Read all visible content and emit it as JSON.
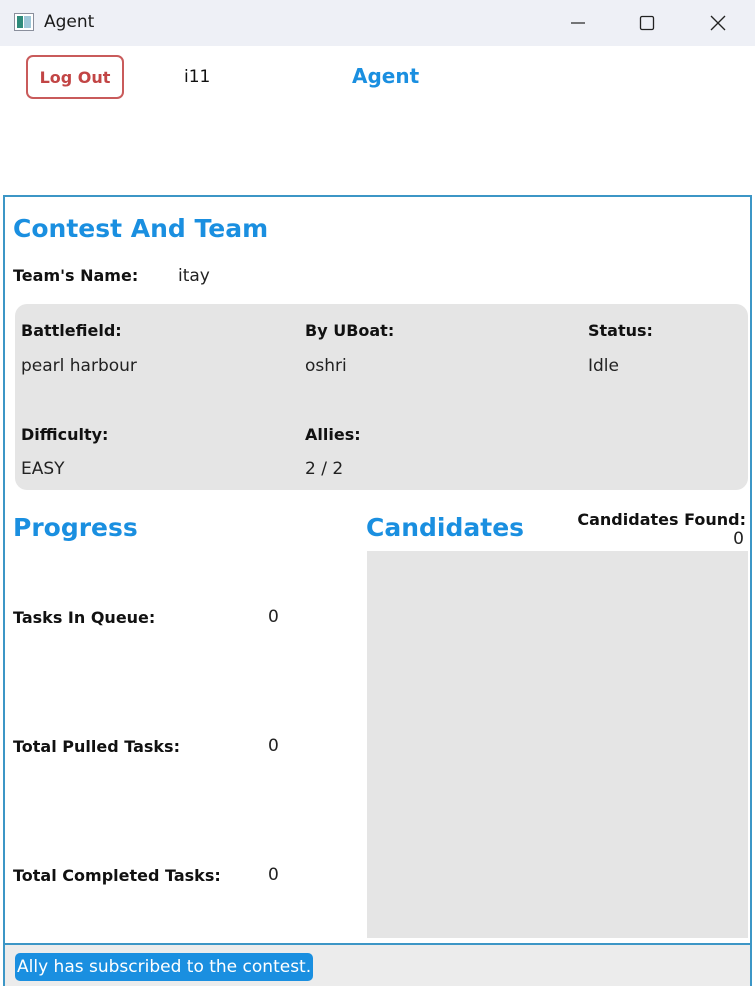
{
  "window": {
    "title": "Agent"
  },
  "header": {
    "logout_label": "Log Out",
    "user": "i11",
    "title": "Agent"
  },
  "contest": {
    "title": "Contest And Team",
    "team_name_label": "Team's Name:",
    "team_name": "itay",
    "battlefield_label": "Battlefield:",
    "battlefield": "pearl harbour",
    "uboat_label": "By UBoat:",
    "uboat": "oshri",
    "status_label": "Status:",
    "status": "Idle",
    "difficulty_label": "Difficulty:",
    "difficulty": "EASY",
    "allies_label": "Allies:",
    "allies": "2 / 2"
  },
  "progress": {
    "title": "Progress",
    "tasks_in_queue_label": "Tasks In Queue:",
    "tasks_in_queue": "0",
    "total_pulled_label": "Total Pulled Tasks:",
    "total_pulled": "0",
    "total_completed_label": "Total Completed Tasks:",
    "total_completed": "0"
  },
  "candidates": {
    "title": "Candidates",
    "found_label": "Candidates Found:",
    "found": "0",
    "items": []
  },
  "status_bar": {
    "message": "Ally has subscribed to the contest."
  },
  "colors": {
    "accent": "#1a8fe0",
    "logout": "#c95b5b",
    "panel_border": "#3c96c6",
    "panel_fill": "#e5e5e5"
  }
}
